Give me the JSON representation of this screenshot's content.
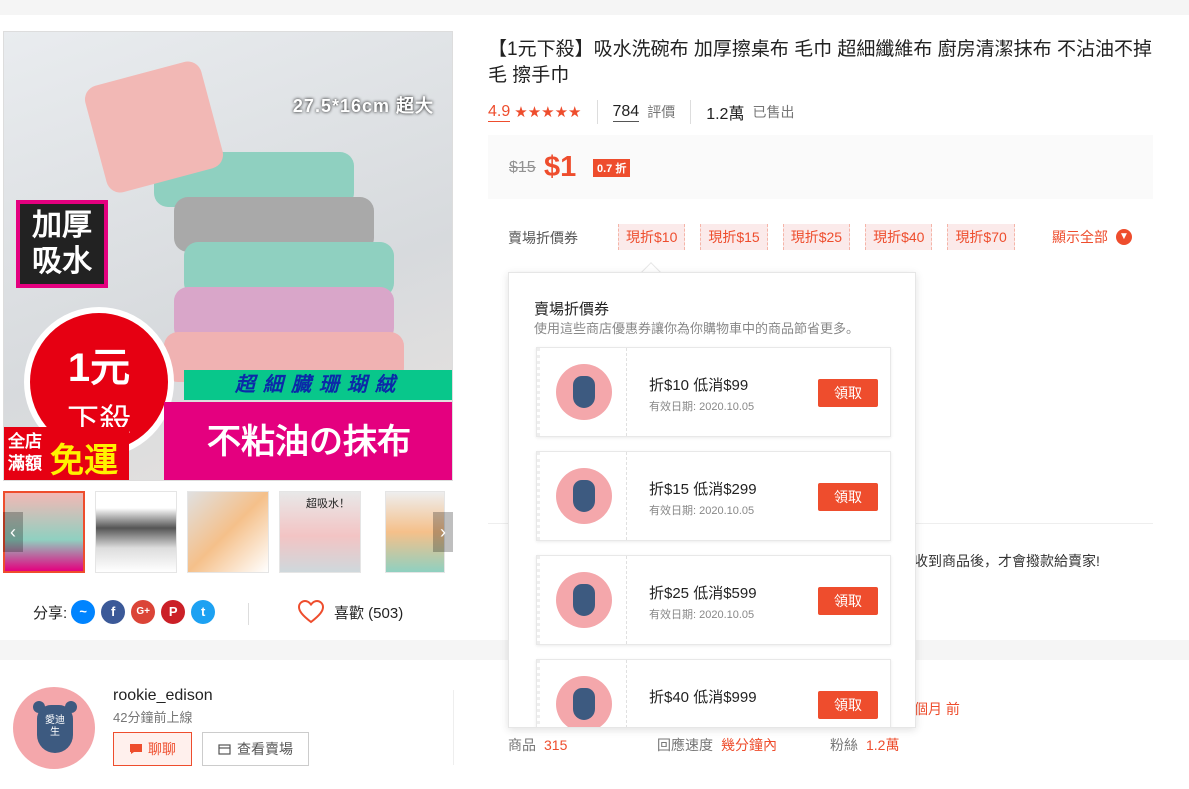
{
  "product": {
    "title": "【1元下殺】吸水洗碗布 加厚擦桌布 毛巾 超細纖維布 廚房清潔抹布 不沾油不掉毛 擦手巾",
    "rating": "4.9",
    "stars": "★★★★★",
    "reviews_count": "784",
    "reviews_label": "評價",
    "sold_count": "1.2萬",
    "sold_label": "已售出",
    "old_price": "$15",
    "price": "$1",
    "discount_badge": "0.7 折"
  },
  "image_promo": {
    "size": "27.5*16cm 超大",
    "thick": "加厚吸水",
    "circle_top": "1元",
    "circle_bottom": "下殺",
    "banner_top": "超細臓珊瑚絨",
    "banner_main": "不粘油の抹布",
    "free_small": "全店滿額",
    "free_large": "免運",
    "thumb3_label": "超吸水！"
  },
  "vouchers_row": {
    "label": "賣場折價券",
    "tags": [
      "現折$10",
      "現折$15",
      "現折$25",
      "現折$40",
      "現折$70"
    ],
    "show_all": "顯示全部"
  },
  "popup": {
    "title": "賣場折價券",
    "subtitle": "使用這些商店優惠券讓你為你購物車中的商品節省更多。",
    "cards": [
      {
        "name": "折$10 低消$99",
        "expiry": "有效日期: 2020.10.05",
        "button": "領取"
      },
      {
        "name": "折$15 低消$299",
        "expiry": "有效日期: 2020.10.05",
        "button": "領取"
      },
      {
        "name": "折$25 低消$599",
        "expiry": "有效日期: 2020.10.05",
        "button": "領取"
      },
      {
        "name": "折$40 低消$999",
        "expiry": "",
        "button": "領取"
      }
    ],
    "avatar_text": "愛迪生"
  },
  "guarantee_text": "收到商品後，才會撥款給賣家!",
  "share": {
    "label": "分享:",
    "icons": [
      "messenger-icon",
      "facebook-icon",
      "google-plus-icon",
      "pinterest-icon",
      "twitter-icon"
    ],
    "glyphs": [
      "~",
      "f",
      "G+",
      "P",
      "t"
    ],
    "colors": [
      "#0084ff",
      "#3b5998",
      "#db4437",
      "#cb2027",
      "#1da1f2"
    ]
  },
  "like": {
    "label": "喜歡 (503)"
  },
  "shop": {
    "name": "rookie_edison",
    "online": "42分鐘前上線",
    "chat_label": "聊聊",
    "view_label": "查看賣場",
    "products_label": "商品",
    "products_value": "315",
    "response_label": "回應速度",
    "response_value": "幾分鐘內",
    "followers_label": "粉絲",
    "followers_value": "1.2萬",
    "joined_fragment": "個月 前"
  },
  "colors": {
    "accent": "#ee4d2d"
  }
}
